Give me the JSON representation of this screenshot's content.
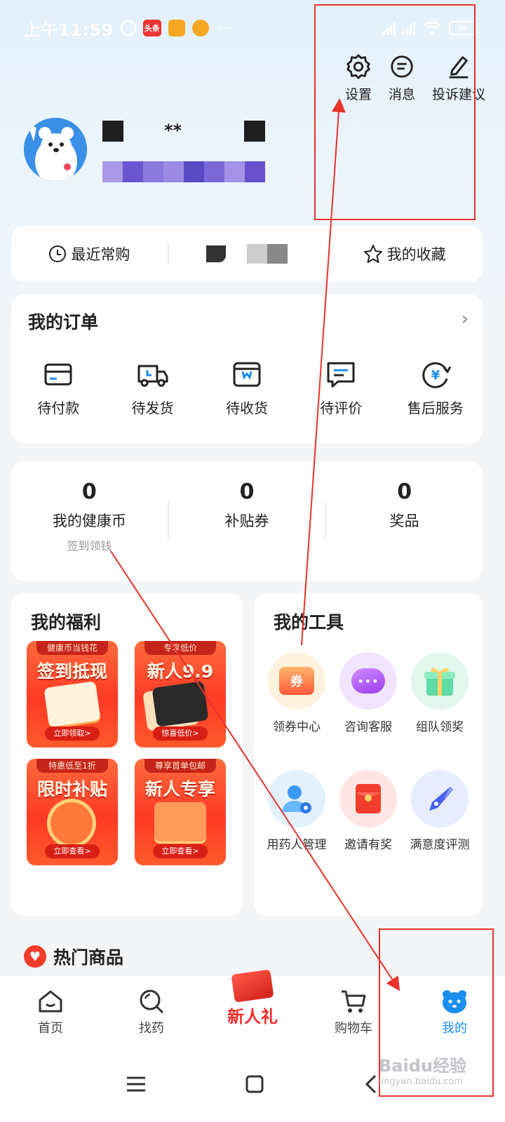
{
  "status_bar": {
    "time": "上午11:59",
    "app_badges": [
      "头条",
      "",
      ""
    ],
    "more": "···",
    "battery": "98"
  },
  "header_actions": [
    {
      "label": "设置",
      "icon": "gear-icon"
    },
    {
      "label": "消息",
      "icon": "message-icon"
    },
    {
      "label": "投诉建议",
      "icon": "edit-icon"
    }
  ],
  "profile": {
    "name_masked": "**"
  },
  "quick_links": {
    "recent": "最近常购",
    "favorites": "我的收藏"
  },
  "orders": {
    "title": "我的订单",
    "chevron": "›",
    "items": [
      {
        "label": "待付款",
        "icon": "wallet-icon"
      },
      {
        "label": "待发货",
        "icon": "truck-icon"
      },
      {
        "label": "待收货",
        "icon": "box-icon"
      },
      {
        "label": "待评价",
        "icon": "comment-icon"
      },
      {
        "label": "售后服务",
        "icon": "yuan-refresh-icon"
      }
    ]
  },
  "stats": [
    {
      "value": "0",
      "label": "我的健康币",
      "sub": "签到领钱"
    },
    {
      "value": "0",
      "label": "补贴券",
      "sub": ""
    },
    {
      "value": "0",
      "label": "奖品",
      "sub": ""
    }
  ],
  "welfare": {
    "title": "我的福利",
    "tiles": [
      {
        "top": "健康币当钱花",
        "main": "签到抵现",
        "button": "立即领取>"
      },
      {
        "top": "专享低价",
        "main": "新人9.9",
        "button": "惊喜低价>"
      },
      {
        "top": "特惠低至1折",
        "main": "限时补贴",
        "button": "立即查看>"
      },
      {
        "top": "尊享首单包邮",
        "main": "新人专享",
        "button": "立即查看>"
      }
    ]
  },
  "tools": {
    "title": "我的工具",
    "items": [
      {
        "label": "领券中心",
        "icon": "coupon-icon",
        "glyph": "券",
        "color": "#fff3e0",
        "fg": "#ff6a3d"
      },
      {
        "label": "咨询客服",
        "icon": "chat-bubble-icon",
        "glyph": "•••",
        "color": "#f1e4ff",
        "fg": "#b35cf5"
      },
      {
        "label": "组队领奖",
        "icon": "gift-icon",
        "glyph": "🎁",
        "color": "#e2f8ee",
        "fg": "#3ccf8e"
      },
      {
        "label": "用药人管理",
        "icon": "user-manage-icon",
        "glyph": "👤",
        "color": "#e3f1ff",
        "fg": "#3a9af5"
      },
      {
        "label": "邀请有奖",
        "icon": "red-envelope-icon",
        "glyph": "✉",
        "color": "#ffe5e3",
        "fg": "#f23d2c"
      },
      {
        "label": "满意度评测",
        "icon": "pen-icon",
        "glyph": "✒",
        "color": "#e7ecff",
        "fg": "#4a62f2"
      }
    ]
  },
  "hot": {
    "title": "热门商品",
    "icon": "heart-icon"
  },
  "tabbar": [
    {
      "label": "首页",
      "icon": "home-icon",
      "active": false
    },
    {
      "label": "找药",
      "icon": "search-icon",
      "active": false
    },
    {
      "label": "新人礼",
      "icon": "gift-promo-icon",
      "active": false
    },
    {
      "label": "购物车",
      "icon": "cart-icon",
      "active": false
    },
    {
      "label": "我的",
      "icon": "bear-icon",
      "active": true
    }
  ],
  "system_nav": [
    "menu-icon",
    "home-square-icon",
    "back-icon"
  ],
  "watermark": {
    "brand": "Baidu经验",
    "url": "jingyan.baidu.com"
  },
  "colors": {
    "accent": "#1c8ef0",
    "annotation": "#e8322b",
    "promo": "#ff3a25"
  }
}
